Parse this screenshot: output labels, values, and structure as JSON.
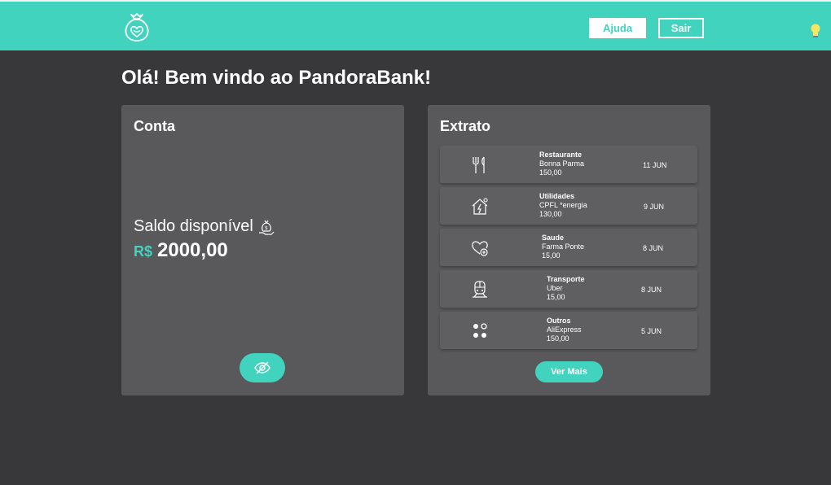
{
  "header": {
    "help_label": "Ajuda",
    "logout_label": "Sair",
    "brand_color": "#41d3be"
  },
  "welcome": "Olá! Bem vindo ao PandoraBank!",
  "account": {
    "title": "Conta",
    "balance_label": "Saldo disponível",
    "currency": "R$",
    "balance": "2000,00"
  },
  "statement": {
    "title": "Extrato",
    "more_label": "Ver Mais",
    "items": [
      {
        "icon": "fork-knife-icon",
        "category": "Restaurante",
        "description": "Bonna Parma",
        "value": "150,00",
        "date": "11 JUN"
      },
      {
        "icon": "house-bolt-icon",
        "category": "Utilidades",
        "description": "CPFL *energia",
        "value": "130,00",
        "date": "9 JUN"
      },
      {
        "icon": "heart-plus-icon",
        "category": "Saude",
        "description": "Farma Ponte",
        "value": "15,00",
        "date": "8 JUN"
      },
      {
        "icon": "train-icon",
        "category": "Transporte",
        "description": "Uber",
        "value": "15,00",
        "date": "8 JUN"
      },
      {
        "icon": "dots-grid-icon",
        "category": "Outros",
        "description": "AliExpress",
        "value": "150,00",
        "date": "5 JUN"
      }
    ]
  }
}
